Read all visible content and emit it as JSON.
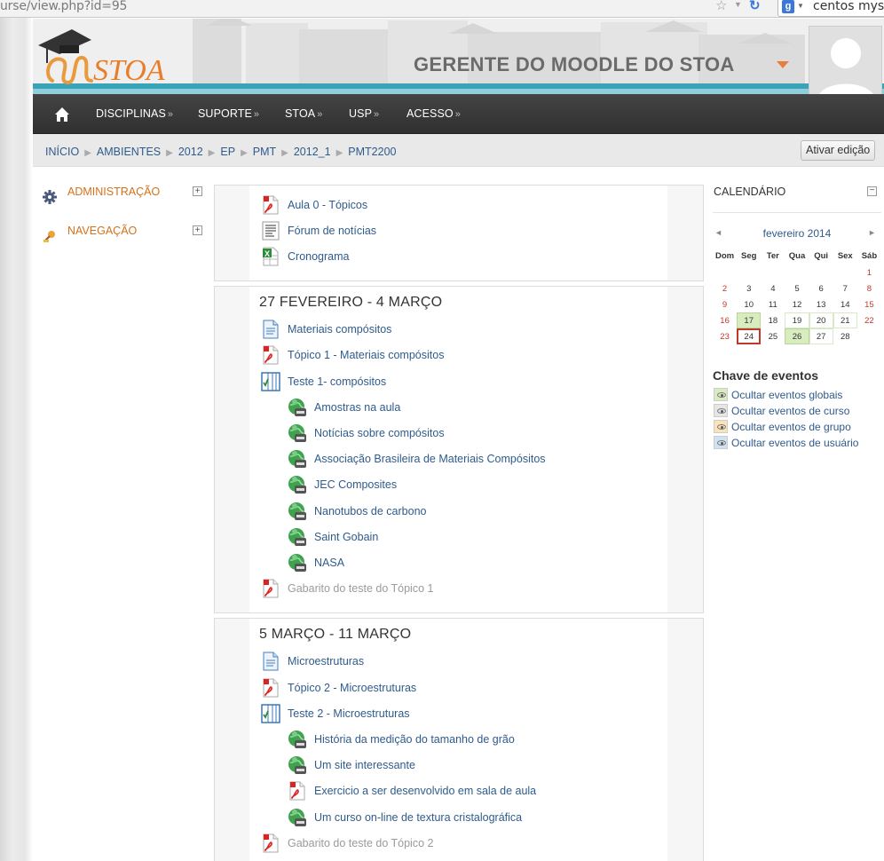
{
  "browser": {
    "url": "urse/view.php?id=95",
    "search_text": "centos mysc"
  },
  "header": {
    "site_name": "GERENTE DO MOODLE DO STOA"
  },
  "nav": {
    "items": [
      "DISCIPLINAS",
      "SUPORTE",
      "STOA",
      "USP",
      "ACESSO"
    ],
    "chevron": "»"
  },
  "breadcrumb": [
    "INÍCIO",
    "AMBIENTES",
    "2012",
    "EP",
    "PMT",
    "2012_1",
    "PMT2200"
  ],
  "edit_button": "Ativar edição",
  "left_blocks": {
    "admin": "ADMINISTRAÇÃO",
    "nav": "NAVEGAÇÃO",
    "toggle": "+"
  },
  "sections": [
    {
      "title": "",
      "activities": [
        {
          "name": "Aula 0 - Tópicos",
          "icon": "pdf-icon"
        },
        {
          "name": "Fórum de notícias",
          "icon": "forum-icon"
        },
        {
          "name": "Cronograma",
          "icon": "spreadsheet-icon"
        }
      ]
    },
    {
      "title": "27 FEVEREIRO - 4 MARÇO",
      "activities": [
        {
          "name": "Materiais compósitos",
          "icon": "document-icon"
        },
        {
          "name": "Tópico 1 - Materiais compósitos",
          "icon": "pdf-icon"
        },
        {
          "name": "Teste 1- compósitos",
          "icon": "quiz-icon"
        },
        {
          "name": "Amostras na aula",
          "icon": "url-icon"
        },
        {
          "name": "Notícias sobre compósitos",
          "icon": "url-icon"
        },
        {
          "name": "Associação Brasileira de Materiais Compósitos",
          "icon": "url-icon"
        },
        {
          "name": "JEC Composites",
          "icon": "url-icon"
        },
        {
          "name": "Nanotubos de carbono",
          "icon": "url-icon"
        },
        {
          "name": "Saint Gobain",
          "icon": "url-icon"
        },
        {
          "name": "NASA",
          "icon": "url-icon"
        },
        {
          "name": "Gabarito do teste do Tópico 1",
          "icon": "pdf-icon"
        }
      ]
    },
    {
      "title": "5 MARÇO - 11 MARÇO",
      "activities": [
        {
          "name": "Microestruturas",
          "icon": "document-icon"
        },
        {
          "name": "Tópico 2 - Microestruturas",
          "icon": "pdf-icon"
        },
        {
          "name": "Teste 2 - Microestruturas",
          "icon": "quiz-icon"
        },
        {
          "name": "História da medição do tamanho de grão",
          "icon": "url-icon"
        },
        {
          "name": "Um site interessante",
          "icon": "url-icon"
        },
        {
          "name": "Exercicio a ser desenvolvido em sala de aula",
          "icon": "pdf-icon"
        },
        {
          "name": "Um curso on-line de textura cristalográfica",
          "icon": "url-icon"
        },
        {
          "name": "Gabarito do teste do Tópico 2",
          "icon": "pdf-icon"
        }
      ]
    }
  ],
  "calendar": {
    "title": "CALENDÁRIO",
    "toggle": "−",
    "month": "fevereiro 2014",
    "prev": "◄",
    "next": "►",
    "weekdays": [
      "Dom",
      "Seg",
      "Ter",
      "Qua",
      "Qui",
      "Sex",
      "Sáb"
    ],
    "weeks": [
      [
        "",
        "",
        "",
        "",
        "",
        "",
        "1"
      ],
      [
        "2",
        "3",
        "4",
        "5",
        "6",
        "7",
        "8"
      ],
      [
        "9",
        "10",
        "11",
        "12",
        "13",
        "14",
        "15"
      ],
      [
        "16",
        "17",
        "18",
        "19",
        "20",
        "21",
        "22"
      ],
      [
        "23",
        "24",
        "25",
        "26",
        "27",
        "28",
        ""
      ]
    ],
    "event_days": [
      "17",
      "26"
    ],
    "outlined_days": [
      "19",
      "20",
      "21",
      "27"
    ],
    "today": "24",
    "key_title": "Chave de eventos",
    "keys": [
      {
        "label": "Ocultar eventos globais",
        "color": "#d8ecc0"
      },
      {
        "label": "Ocultar eventos de curso",
        "color": "#e6e6e6"
      },
      {
        "label": "Ocultar eventos de grupo",
        "color": "#fbe3b8"
      },
      {
        "label": "Ocultar eventos de usuário",
        "color": "#cfe2f3"
      }
    ]
  },
  "colors": {
    "accent_orange": "#d4711b",
    "link_blue": "#2f5b8c",
    "navbar": "#363636",
    "teal": "#3aa3b8"
  }
}
